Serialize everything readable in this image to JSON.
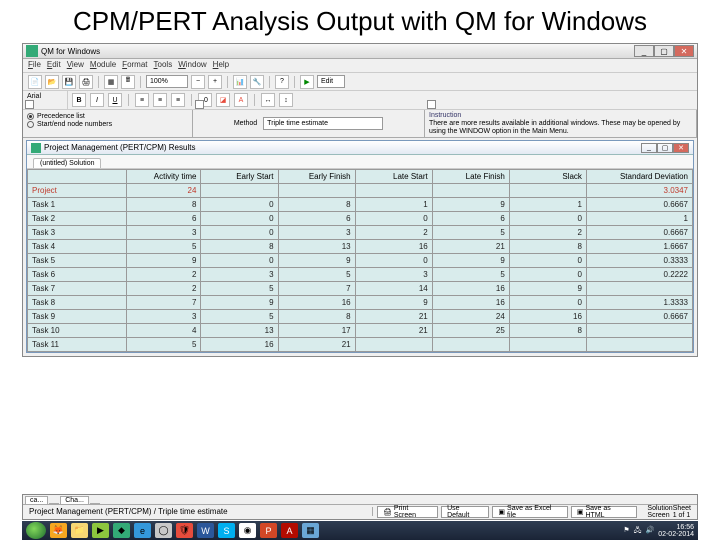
{
  "title": "CPM/PERT Analysis Output with QM for Windows",
  "app": {
    "name": "QM for Windows"
  },
  "menu": [
    "File",
    "Edit",
    "View",
    "Module",
    "Format",
    "Tools",
    "Window",
    "Help"
  ],
  "toolbar1": {
    "zoom": "100%",
    "edit_label": "Edit"
  },
  "row3": {
    "label": "Arial",
    "combo": "Triple time estimate"
  },
  "options": {
    "o1": "Precedence list",
    "o2": "Start/end node numbers"
  },
  "instruct": {
    "hdr": "Instruction",
    "text": "There are more results available in additional windows. These may be opened by using the WINDOW option in the Main Menu."
  },
  "inner": {
    "title": "Project Management (PERT/CPM) Results",
    "tab": "(untitled) Solution"
  },
  "columns": [
    "",
    "Activity time",
    "Early Start",
    "Early Finish",
    "Late Start",
    "Late Finish",
    "Slack",
    "Standard Deviation"
  ],
  "rows": [
    {
      "lbl": "Project",
      "c": [
        "24",
        "",
        "",
        "",
        "",
        "",
        "3.0347"
      ]
    },
    {
      "lbl": "Task 1",
      "c": [
        "8",
        "0",
        "8",
        "1",
        "9",
        "1",
        "0.6667"
      ]
    },
    {
      "lbl": "Task 2",
      "c": [
        "6",
        "0",
        "6",
        "0",
        "6",
        "0",
        "1"
      ]
    },
    {
      "lbl": "Task 3",
      "c": [
        "3",
        "0",
        "3",
        "2",
        "5",
        "2",
        "0.6667"
      ]
    },
    {
      "lbl": "Task 4",
      "c": [
        "5",
        "8",
        "13",
        "16",
        "21",
        "8",
        "1.6667"
      ]
    },
    {
      "lbl": "Task 5",
      "c": [
        "9",
        "0",
        "9",
        "0",
        "9",
        "0",
        "0.3333"
      ]
    },
    {
      "lbl": "Task 6",
      "c": [
        "2",
        "3",
        "5",
        "3",
        "5",
        "0",
        "0.2222"
      ]
    },
    {
      "lbl": "Task 7",
      "c": [
        "2",
        "5",
        "7",
        "14",
        "16",
        "9",
        ""
      ]
    },
    {
      "lbl": "Task 8",
      "c": [
        "7",
        "9",
        "16",
        "9",
        "16",
        "0",
        "1.3333"
      ]
    },
    {
      "lbl": "Task 9",
      "c": [
        "3",
        "5",
        "8",
        "21",
        "24",
        "16",
        "0.6667"
      ]
    },
    {
      "lbl": "Task 10",
      "c": [
        "4",
        "13",
        "17",
        "21",
        "25",
        "8",
        ""
      ]
    },
    {
      "lbl": "Task 11",
      "c": [
        "5",
        "16",
        "21",
        "",
        "",
        "",
        ""
      ]
    }
  ],
  "modulebar": {
    "tabs": [
      "ca...",
      "",
      "Cha...",
      ""
    ],
    "label": "Project Management (PERT/CPM) / Triple time estimate",
    "btns": [
      "Print Screen",
      "Use Default",
      "Save as Excel file",
      "Save as HTML"
    ],
    "mid": "Solution Screen",
    "right": "Sheet 1 of 1"
  },
  "tray": {
    "time": "16:56",
    "date": "02-02-2014"
  }
}
